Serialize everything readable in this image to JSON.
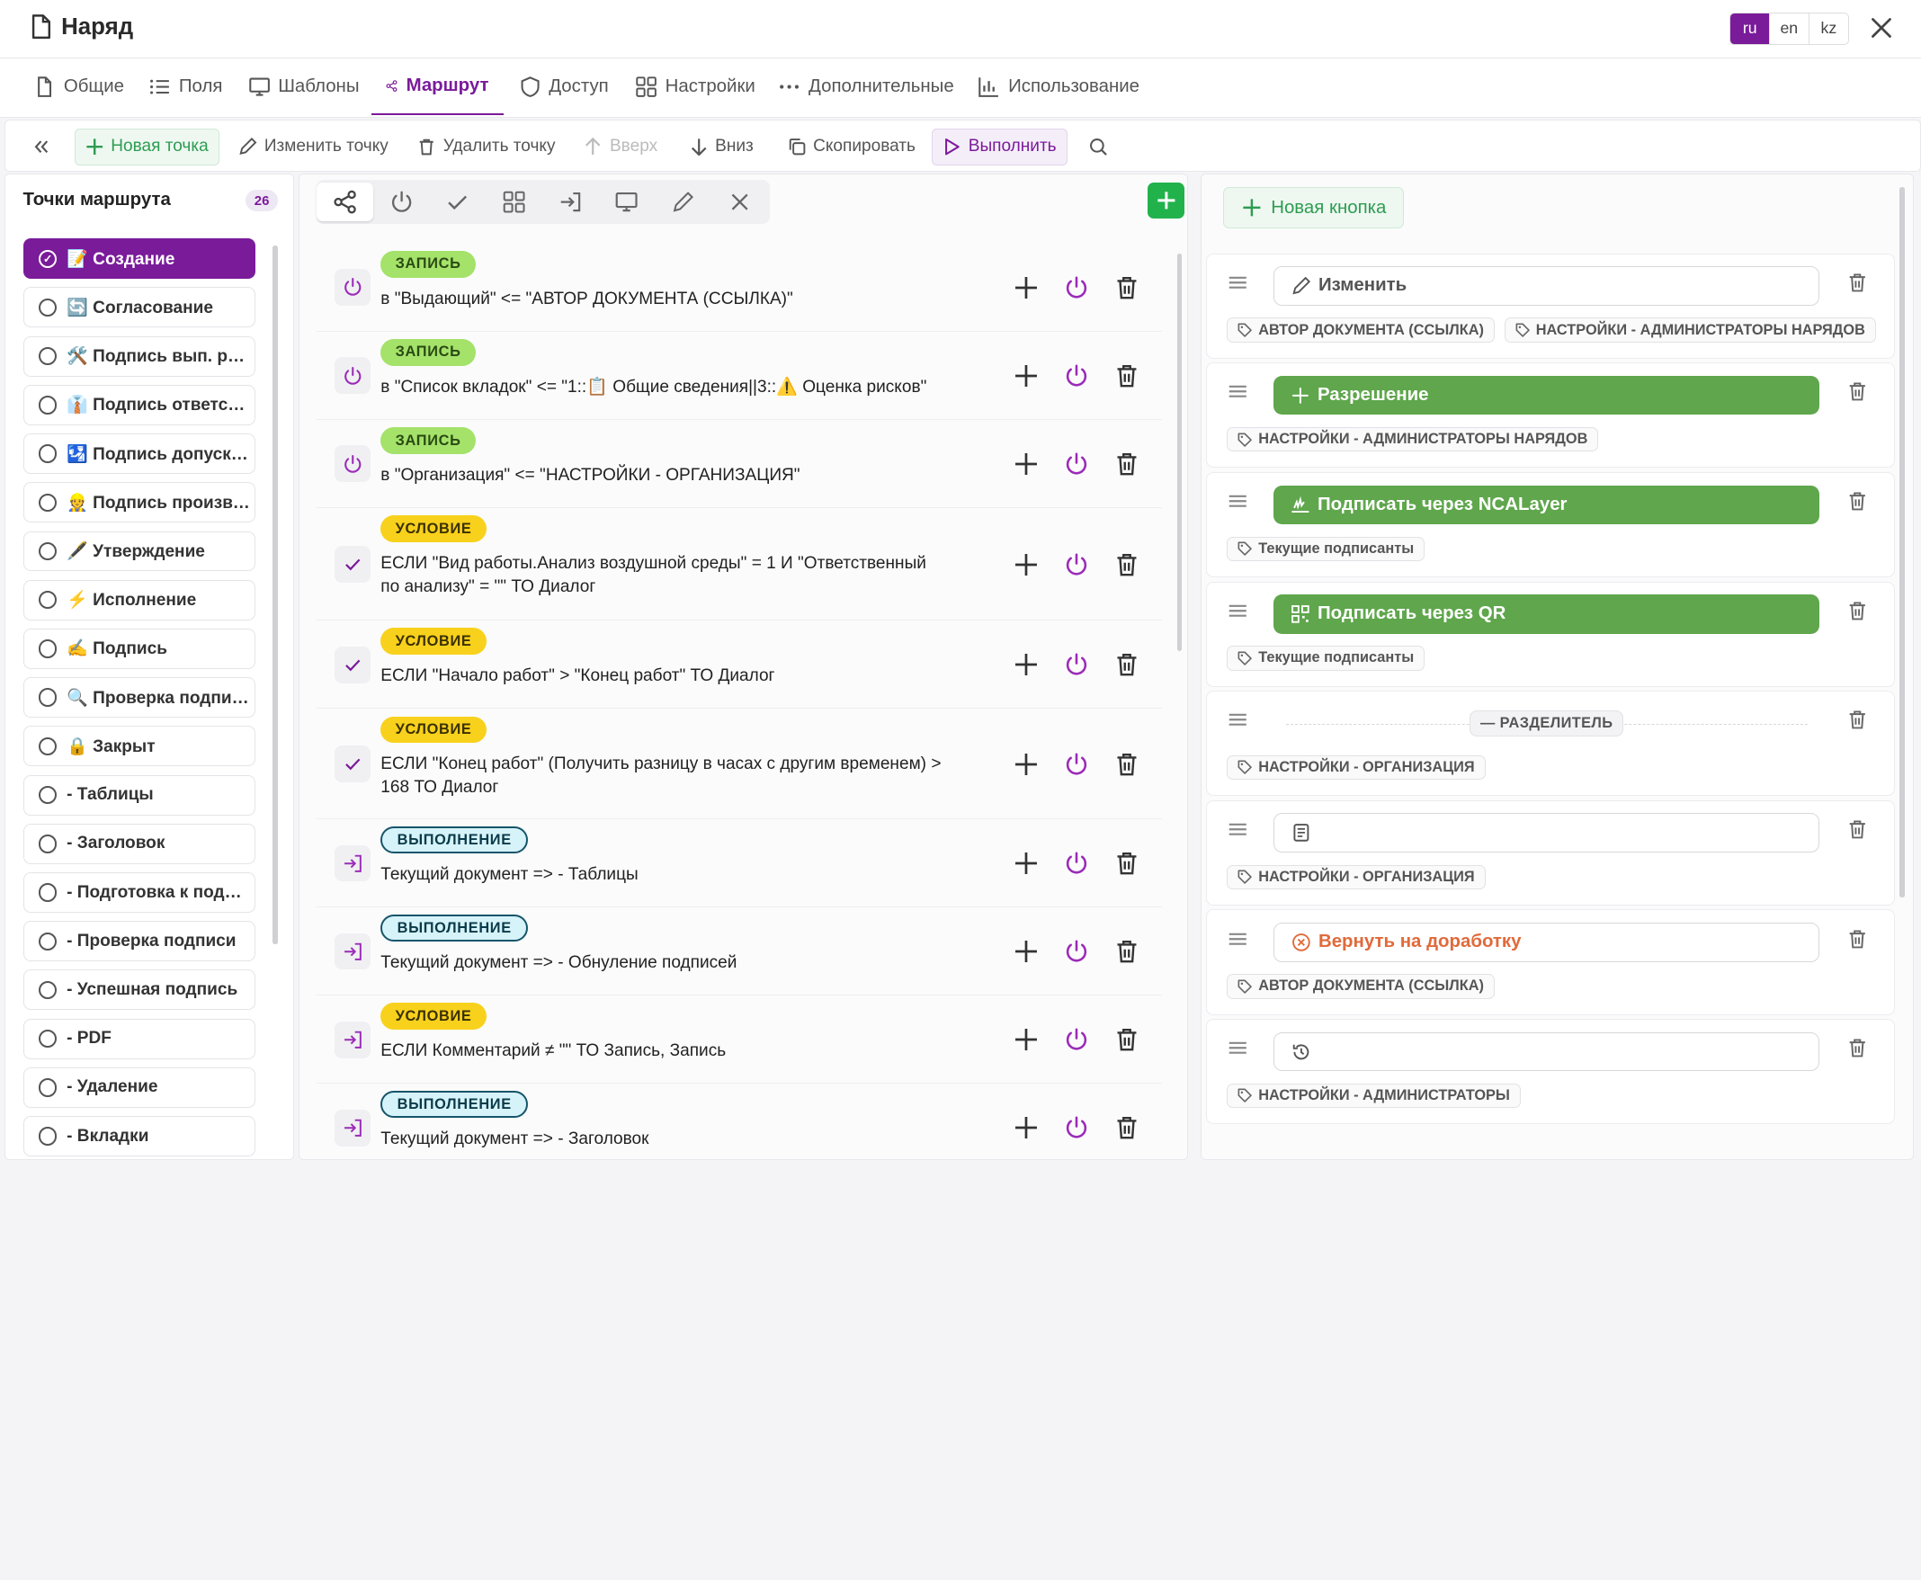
{
  "window": {
    "title": "Наряд"
  },
  "languages": [
    {
      "label": "ru",
      "active": true
    },
    {
      "label": "en",
      "active": false
    },
    {
      "label": "kz",
      "active": false
    }
  ],
  "tabs": [
    {
      "label": "Общие",
      "icon": "file-icon",
      "active": false
    },
    {
      "label": "Поля",
      "icon": "list-icon",
      "active": false
    },
    {
      "label": "Шаблоны",
      "icon": "monitor-icon",
      "active": false
    },
    {
      "label": "Маршрут",
      "icon": "share-icon",
      "active": true
    },
    {
      "label": "Доступ",
      "icon": "shield-icon",
      "active": false
    },
    {
      "label": "Настройки",
      "icon": "grid-icon",
      "active": false
    },
    {
      "label": "Дополнительные",
      "icon": "dots-icon",
      "active": false
    },
    {
      "label": "Использование",
      "icon": "bar-chart-icon",
      "active": false
    }
  ],
  "toolbar": {
    "new_point": "Новая точка",
    "edit_point": "Изменить точку",
    "delete_point": "Удалить точку",
    "up": "Вверх",
    "down": "Вниз",
    "copy": "Скопировать",
    "run": "Выполнить"
  },
  "route_points": {
    "title": "Точки маршрута",
    "count": "26",
    "items": [
      "📝 Создание",
      "🔄 Согласование",
      "🛠️ Подпись вып. работ",
      "👔 Подпись ответственного",
      "🛂 Подпись допускающего",
      "👷 Подпись производителя",
      "🖋️ Утверждение",
      "⚡ Исполнение",
      "✍️ Подпись",
      "🔍 Проверка подписи",
      "🔒 Закрыт",
      "- Таблицы",
      "- Заголовок",
      "- Подготовка к подписи",
      "- Проверка подписи",
      "- Успешная подпись",
      "- PDF",
      "- Удаление",
      "- Вкладки"
    ]
  },
  "steps": [
    {
      "badge": "ЗАПИСЬ",
      "kind": "w",
      "icon": "power-icon",
      "text": "в \"Выдающий\" <= \"АВТОР ДОКУМЕНТА (ССЫЛКА)\""
    },
    {
      "badge": "ЗАПИСЬ",
      "kind": "w",
      "icon": "power-icon",
      "text": "в \"Список вкладок\" <= \"1::📋 Общие сведения||3::⚠️ Оценка рисков\""
    },
    {
      "badge": "ЗАПИСЬ",
      "kind": "w",
      "icon": "power-icon",
      "text": "в \"Организация\" <= \"НАСТРОЙКИ - ОРГАНИЗАЦИЯ\""
    },
    {
      "badge": "УСЛОВИЕ",
      "kind": "c",
      "icon": "check-icon",
      "text": "ЕСЛИ \"Вид работы.Анализ воздушной среды\" = 1 И \"Ответственный по анализу\" = \"\" ТО Диалог"
    },
    {
      "badge": "УСЛОВИЕ",
      "kind": "c",
      "icon": "check-icon",
      "text": "ЕСЛИ \"Начало работ\" > \"Конец работ\" ТО Диалог"
    },
    {
      "badge": "УСЛОВИЕ",
      "kind": "c",
      "icon": "check-icon",
      "text": "ЕСЛИ \"Конец работ\" (Получить разницу в часах с другим временем) > 168 ТО Диалог"
    },
    {
      "badge": "ВЫПОЛНЕНИЕ",
      "kind": "e",
      "icon": "enter-icon",
      "text": "Текущий документ => - Таблицы"
    },
    {
      "badge": "ВЫПОЛНЕНИЕ",
      "kind": "e",
      "icon": "enter-icon",
      "text": "Текущий документ => - Обнуление подписей"
    },
    {
      "badge": "УСЛОВИЕ",
      "kind": "c",
      "icon": "enter-icon",
      "text": "ЕСЛИ Комментарий ≠ \"\" ТО Запись, Запись"
    },
    {
      "badge": "ВЫПОЛНЕНИЕ",
      "kind": "e",
      "icon": "enter-icon",
      "text": "Текущий документ => - Заголовок"
    }
  ],
  "buttons_panel": {
    "new_button": "Новая кнопка",
    "cards": [
      {
        "style": "out",
        "icon": "pencil-icon",
        "label": "Изменить",
        "tags": [
          "АВТОР ДОКУМЕНТА (ССЫЛКА)",
          "НАСТРОЙКИ - АДМИНИСТРАТОРЫ НАРЯДОВ"
        ]
      },
      {
        "style": "grn",
        "icon": "plus-icon",
        "label": "Разрешение",
        "tags": [
          "НАСТРОЙКИ - АДМИНИСТРАТОРЫ НАРЯДОВ"
        ]
      },
      {
        "style": "grn",
        "icon": "sign-icon",
        "label": "Подписать через NCALayer",
        "tags": [
          "Текущие подписанты"
        ]
      },
      {
        "style": "grn",
        "icon": "qr-icon",
        "label": "Подписать через QR",
        "tags": [
          "Текущие подписанты"
        ]
      },
      {
        "style": "sep",
        "icon": "dash-icon",
        "label": "— РАЗДЕЛИТЕЛЬ",
        "tags": [
          "НАСТРОЙКИ - ОРГАНИЗАЦИЯ"
        ]
      },
      {
        "style": "out",
        "icon": "document-icon",
        "label": "",
        "tags": [
          "НАСТРОЙКИ - ОРГАНИЗАЦИЯ"
        ]
      },
      {
        "style": "red",
        "icon": "cancel-circle-icon",
        "label": "Вернуть на доработку",
        "tags": [
          "АВТОР ДОКУМЕНТА (ССЫЛКА)"
        ]
      },
      {
        "style": "out",
        "icon": "history-icon",
        "label": "",
        "tags": [
          "НАСТРОЙКИ - АДМИНИСТРАТОРЫ"
        ]
      }
    ]
  },
  "colors": {
    "accent": "#7a1b9a",
    "green": "#22b24c",
    "button_green": "#5fa64c",
    "return": "#e06a3a"
  }
}
